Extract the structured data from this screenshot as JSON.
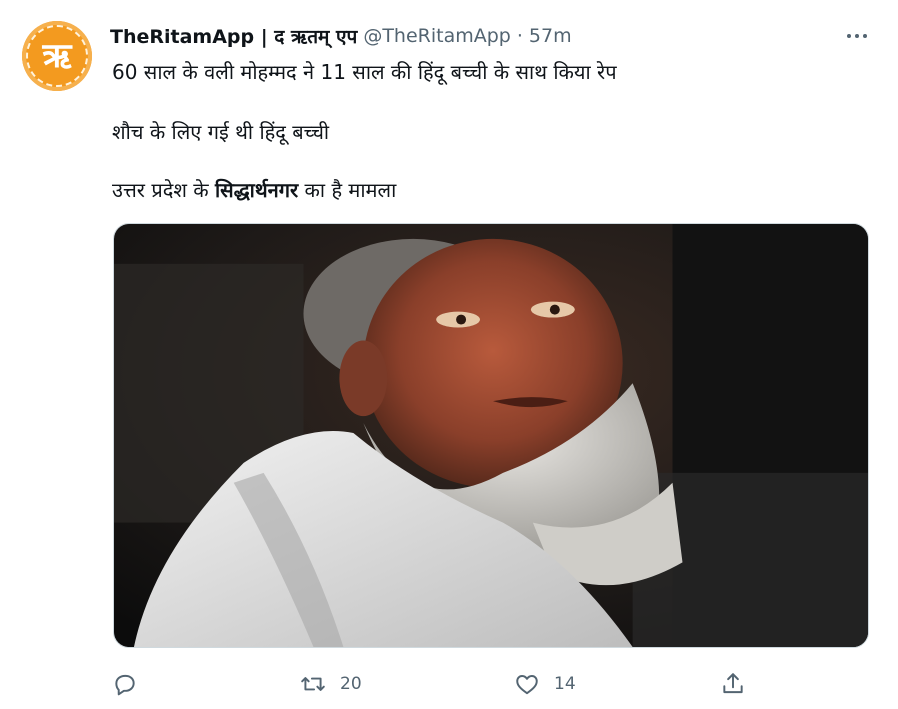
{
  "tweet": {
    "author_name": "TheRitamApp | द ऋतम् एप",
    "handle": "@TheRitamApp",
    "separator": "·",
    "time": "57m",
    "avatar_glyph": "ऋ",
    "text_line1": "60 साल के वली मोहम्मद ने 11 साल की हिंदू बच्ची के साथ किया रेप",
    "text_line2": "शौच के लिए गई थी हिंदू बच्ची",
    "text_line3_prefix": "उत्तर प्रदेश के ",
    "text_line3_bold": "सिद्धार्थनगर",
    "text_line3_suffix": " का है मामला"
  },
  "actions": {
    "replies": "",
    "retweets": "20",
    "likes": "14"
  },
  "colors": {
    "avatar_bg": "#f39a1f",
    "muted": "#536471",
    "text": "#0f1419"
  },
  "icons": [
    "more-icon",
    "reply-icon",
    "retweet-icon",
    "like-icon",
    "share-icon"
  ]
}
